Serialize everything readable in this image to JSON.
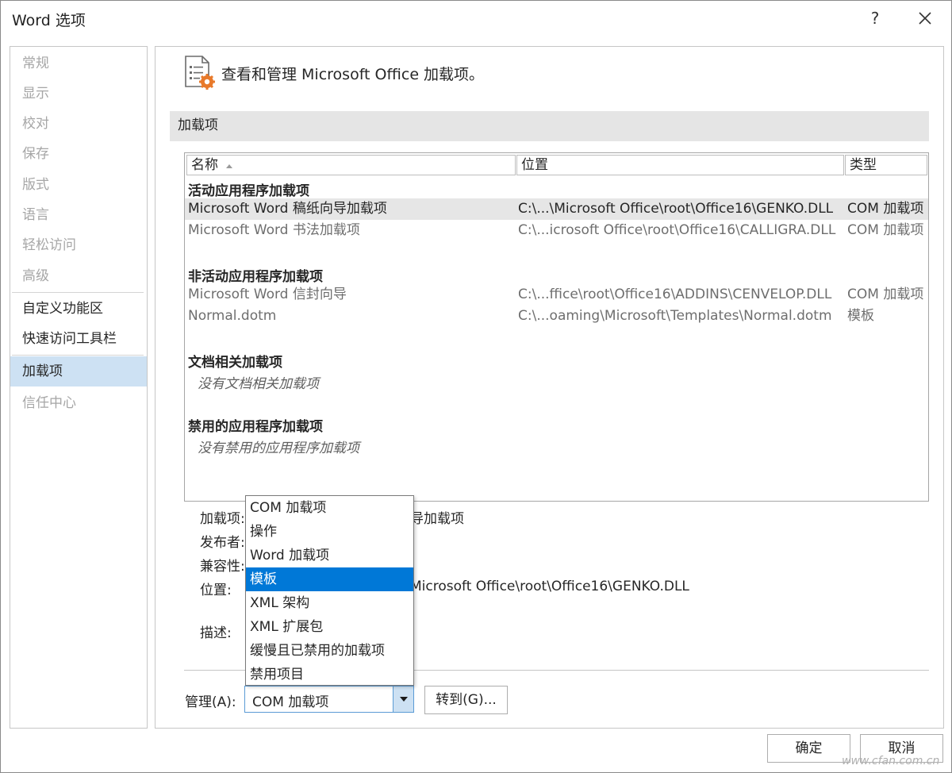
{
  "window": {
    "title": "Word 选项",
    "help": "?"
  },
  "sidebar": {
    "items": [
      {
        "label": "常规",
        "state": "disabled"
      },
      {
        "label": "显示",
        "state": "disabled"
      },
      {
        "label": "校对",
        "state": "disabled"
      },
      {
        "label": "保存",
        "state": "disabled"
      },
      {
        "label": "版式",
        "state": "disabled"
      },
      {
        "label": "语言",
        "state": "disabled"
      },
      {
        "label": "轻松访问",
        "state": "disabled"
      },
      {
        "label": "高级",
        "state": "disabled"
      },
      {
        "label": "自定义功能区",
        "state": "enabled"
      },
      {
        "label": "快速访问工具栏",
        "state": "enabled"
      },
      {
        "label": "加载项",
        "state": "selected"
      },
      {
        "label": "信任中心",
        "state": "disabled"
      }
    ]
  },
  "main": {
    "header": "查看和管理 Microsoft Office 加载项。",
    "section_title": "加载项",
    "columns": [
      "名称",
      "位置",
      "类型"
    ],
    "groups": {
      "active": {
        "label": "活动应用程序加载项",
        "rows": [
          {
            "name": "Microsoft Word 稿纸向导加载项",
            "location": "C:\\...\\Microsoft Office\\root\\Office16\\GENKO.DLL",
            "type": "COM 加载项"
          },
          {
            "name": "Microsoft Word 书法加载项",
            "location": "C:\\...icrosoft Office\\root\\Office16\\CALLIGRA.DLL",
            "type": "COM 加载项"
          }
        ]
      },
      "inactive": {
        "label": "非活动应用程序加载项",
        "rows": [
          {
            "name": "Microsoft Word 信封向导",
            "location": "C:\\...ffice\\root\\Office16\\ADDINS\\CENVELOP.DLL",
            "type": "COM 加载项"
          },
          {
            "name": "Normal.dotm",
            "location": "C:\\...oaming\\Microsoft\\Templates\\Normal.dotm",
            "type": "模板"
          }
        ]
      },
      "document": {
        "label": "文档相关加载项",
        "empty": "没有文档相关加载项"
      },
      "disabled": {
        "label": "禁用的应用程序加载项",
        "empty": "没有禁用的应用程序加载项"
      }
    },
    "details": {
      "addin_label": "加载项:",
      "addin_value_visible": "导加载项",
      "publisher_label": "发布者:",
      "compat_label": "兼容性:",
      "location_label": "位置:",
      "location_value_visible": "Microsoft Office\\root\\Office16\\GENKO.DLL",
      "description_label": "描述:"
    },
    "manage": {
      "label": "管理(A):",
      "selected": "COM 加载项",
      "go_button": "转到(G)...",
      "options": [
        "COM 加载项",
        "操作",
        "Word 加载项",
        "模板",
        "XML 架构",
        "XML 扩展包",
        "缓慢且已禁用的加载项",
        "禁用项目"
      ],
      "highlighted_option": "模板"
    }
  },
  "footer": {
    "ok": "确定",
    "cancel": "取消"
  },
  "watermark": "www.cfan.com.cn",
  "colors": {
    "accent": "#0078d7",
    "selected_nav": "#cde1f3",
    "section_bar": "#e5e5e5"
  }
}
